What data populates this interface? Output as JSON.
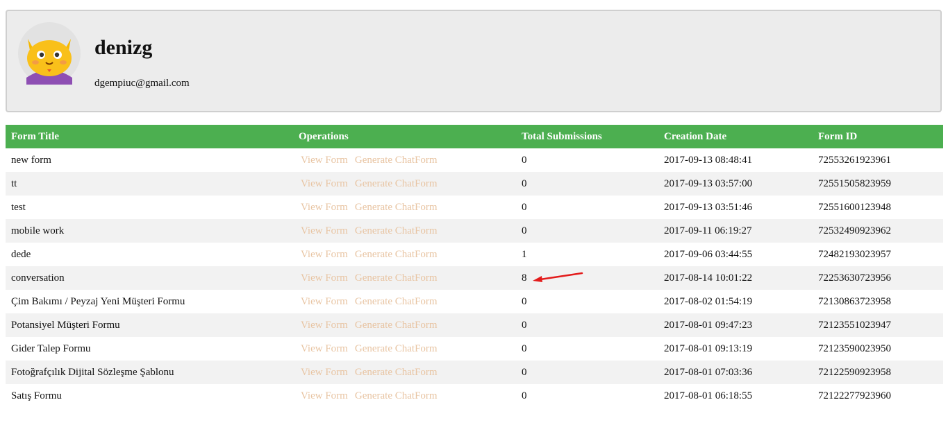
{
  "profile": {
    "username": "denizg",
    "email": "dgempiuc@gmail.com",
    "avatar_icon": "cat-avatar-icon"
  },
  "table": {
    "headers": {
      "title": "Form Title",
      "operations": "Operations",
      "submissions": "Total Submissions",
      "date": "Creation Date",
      "id": "Form ID"
    },
    "op_labels": {
      "view": "View Form",
      "generate": "Generate ChatForm"
    },
    "rows": [
      {
        "title": "new form",
        "submissions": "0",
        "date": "2017-09-13 08:48:41",
        "id": "72553261923961"
      },
      {
        "title": "tt",
        "submissions": "0",
        "date": "2017-09-13 03:57:00",
        "id": "72551505823959"
      },
      {
        "title": "test",
        "submissions": "0",
        "date": "2017-09-13 03:51:46",
        "id": "72551600123948"
      },
      {
        "title": "mobile work",
        "submissions": "0",
        "date": "2017-09-11 06:19:27",
        "id": "72532490923962"
      },
      {
        "title": "dede",
        "submissions": "1",
        "date": "2017-09-06 03:44:55",
        "id": "72482193023957"
      },
      {
        "title": "conversation",
        "submissions": "8",
        "date": "2017-08-14 10:01:22",
        "id": "72253630723956"
      },
      {
        "title": "Çim Bakımı / Peyzaj Yeni Müşteri Formu",
        "submissions": "0",
        "date": "2017-08-02 01:54:19",
        "id": "72130863723958"
      },
      {
        "title": "Potansiyel Müşteri Formu",
        "submissions": "0",
        "date": "2017-08-01 09:47:23",
        "id": "72123551023947"
      },
      {
        "title": "Gider Talep Formu",
        "submissions": "0",
        "date": "2017-08-01 09:13:19",
        "id": "72123590023950"
      },
      {
        "title": "Fotoğrafçılık Dijital Sözleşme Şablonu",
        "submissions": "0",
        "date": "2017-08-01 07:03:36",
        "id": "72122590923958"
      },
      {
        "title": "Satış Formu",
        "submissions": "0",
        "date": "2017-08-01 06:18:55",
        "id": "72122277923960"
      }
    ]
  },
  "colors": {
    "header_bg": "#4caf50",
    "link": "#e8c4a2",
    "annotation_arrow": "#e31b1b"
  }
}
